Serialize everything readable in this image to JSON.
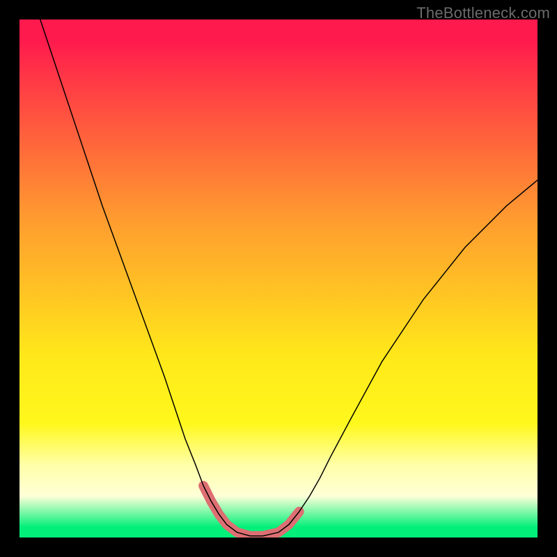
{
  "watermark": "TheBottleneck.com",
  "chart_data": {
    "type": "line",
    "title": "",
    "xlabel": "",
    "ylabel": "",
    "xlim": [
      0,
      1
    ],
    "ylim": [
      0,
      1
    ],
    "series": [
      {
        "name": "curve",
        "stroke": "#000000",
        "stroke_width": 1.5,
        "x": [
          0.04,
          0.08,
          0.12,
          0.16,
          0.2,
          0.24,
          0.28,
          0.3,
          0.32,
          0.34,
          0.355,
          0.37,
          0.385,
          0.4,
          0.42,
          0.445,
          0.47,
          0.5,
          0.52,
          0.54,
          0.56,
          0.58,
          0.6,
          0.64,
          0.7,
          0.78,
          0.86,
          0.94,
          1.0
        ],
        "y": [
          1.0,
          0.88,
          0.76,
          0.64,
          0.53,
          0.42,
          0.31,
          0.25,
          0.19,
          0.14,
          0.1,
          0.07,
          0.045,
          0.025,
          0.01,
          0.003,
          0.003,
          0.01,
          0.025,
          0.05,
          0.08,
          0.115,
          0.155,
          0.23,
          0.34,
          0.46,
          0.56,
          0.64,
          0.69
        ]
      },
      {
        "name": "bottom-highlight",
        "stroke": "#dd6f73",
        "stroke_width": 14,
        "linecap": "round",
        "x": [
          0.355,
          0.37,
          0.385,
          0.4,
          0.42,
          0.445,
          0.47,
          0.5,
          0.52,
          0.54
        ],
        "y": [
          0.1,
          0.07,
          0.045,
          0.025,
          0.01,
          0.003,
          0.003,
          0.01,
          0.025,
          0.05
        ]
      }
    ]
  }
}
